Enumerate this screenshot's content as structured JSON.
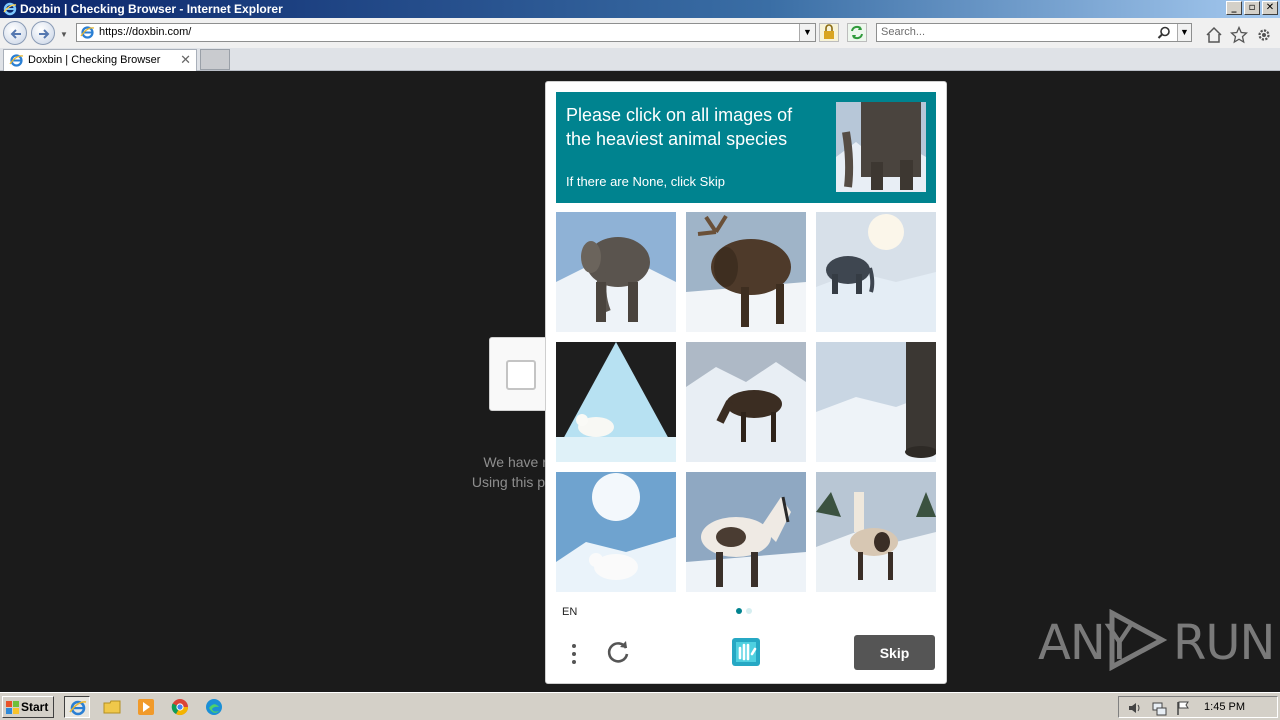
{
  "window": {
    "title": "Doxbin | Checking Browser - Internet Explorer",
    "controls": [
      "_",
      "▫",
      "✕"
    ]
  },
  "navbar": {
    "address": "https://doxbin.com/",
    "search_placeholder": "Search..."
  },
  "tabs": [
    {
      "title": "Doxbin | Checking Browser",
      "close": "✕"
    }
  ],
  "page": {
    "text_line1": "We have registere",
    "text_line2": "Using this page, we w"
  },
  "captcha": {
    "prompt": "Please click on all images of the heaviest animal species",
    "sub_prompt": "If there are None, click Skip",
    "example_image": "elephant-in-snow",
    "tiles": [
      {
        "subject": "elephant"
      },
      {
        "subject": "moose"
      },
      {
        "subject": "elephant"
      },
      {
        "subject": "polar-bear"
      },
      {
        "subject": "moose"
      },
      {
        "subject": "elephant-leg"
      },
      {
        "subject": "polar-bear"
      },
      {
        "subject": "horse"
      },
      {
        "subject": "llama"
      }
    ],
    "language": "EN",
    "page_indicator": {
      "total": 2,
      "active": 1
    },
    "skip_label": "Skip",
    "accent": "#00838f"
  },
  "watermark": {
    "left": "ANY",
    "right": "RUN"
  },
  "taskbar": {
    "start_label": "Start",
    "apps": [
      "internet-explorer-icon",
      "file-explorer-icon",
      "media-player-icon",
      "chrome-icon",
      "edge-icon"
    ],
    "clock": "1:45 PM"
  }
}
